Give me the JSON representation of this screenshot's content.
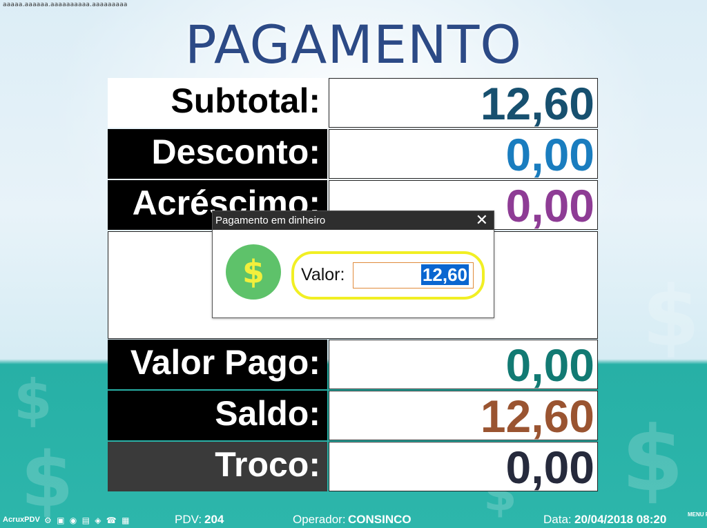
{
  "top_note": "aaaaa.aaaaaa.aaaaaaaaaa.aaaaaaaaa",
  "title": "PAGAMENTO",
  "rows": {
    "subtotal": {
      "label": "Subtotal:",
      "value": "12,60",
      "color": "#17506f"
    },
    "desconto": {
      "label": "Desconto:",
      "value": "0,00",
      "color": "#1a7dbf"
    },
    "acrescimo": {
      "label": "Acréscimo:",
      "value": "0,00",
      "color": "#8e3c95"
    },
    "valor_pago": {
      "label": "Valor Pago:",
      "value": "0,00",
      "color": "#127a73"
    },
    "saldo": {
      "label": "Saldo:",
      "value": "12,60",
      "color": "#9a5431"
    },
    "troco": {
      "label": "Troco:",
      "value": "0,00",
      "color": "#262a3c"
    }
  },
  "dialog": {
    "title": "Pagamento em dinheiro",
    "close_icon": "close-icon",
    "coin_symbol": "$",
    "valor_label": "Valor:",
    "valor_value": "12,60"
  },
  "taskbar": {
    "app_name": "AcruxPDV",
    "pdv_label": "PDV:",
    "pdv_value": "204",
    "operador_label": "Operador:",
    "operador_value": "CONSINCO",
    "data_label": "Data:",
    "data_value": "20/04/2018 08:20",
    "menu_fiscal": "MENU FISCAL"
  },
  "colors": {
    "title": "#2c4a86",
    "accent_teal": "#2db6ab",
    "selection": "#0a66d0",
    "highlight": "#f1ef24",
    "coin": "#5ec26a"
  }
}
